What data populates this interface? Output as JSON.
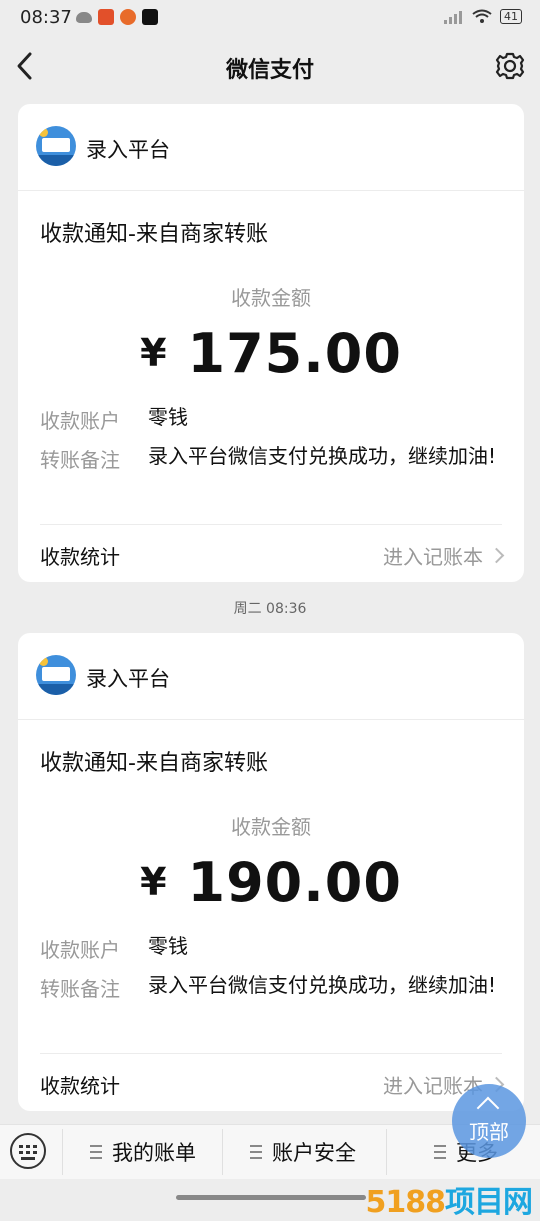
{
  "status_bar": {
    "time": "08:37",
    "battery": "41",
    "app_icons": [
      "cloud-icon",
      "red-app-icon",
      "orange-app-icon",
      "tiktok-icon"
    ],
    "app_icon_colors": [
      "#888888",
      "#e2502a",
      "#e86b2a",
      "#111111"
    ]
  },
  "header": {
    "title": "微信支付"
  },
  "messages": [
    {
      "app_name": "录入平台",
      "notice_title": "收款通知-来自商家转账",
      "amount_label": "收款金额",
      "currency": "¥",
      "amount": "175.00",
      "account_label": "收款账户",
      "account_value": "零钱",
      "remark_label": "转账备注",
      "remark_value": "录入平台微信支付兑换成功，继续加油!",
      "stats_label": "收款统计",
      "ledger_link": "进入记账本"
    },
    {
      "app_name": "录入平台",
      "notice_title": "收款通知-来自商家转账",
      "amount_label": "收款金额",
      "currency": "¥",
      "amount": "190.00",
      "account_label": "收款账户",
      "account_value": "零钱",
      "remark_label": "转账备注",
      "remark_value": "录入平台微信支付兑换成功，继续加油!",
      "stats_label": "收款统计",
      "ledger_link": "进入记账本"
    }
  ],
  "timestamp": "周二 08:36",
  "bottom_menu": {
    "items": [
      "我的账单",
      "账户安全",
      "更多"
    ]
  },
  "scroll_top_label": "顶部",
  "watermark": {
    "num": "5188",
    "text": "项目网"
  },
  "colors": {
    "background": "#ededed",
    "card": "#ffffff",
    "muted_text": "#999999",
    "accent_blue": "#3f8fdc"
  }
}
